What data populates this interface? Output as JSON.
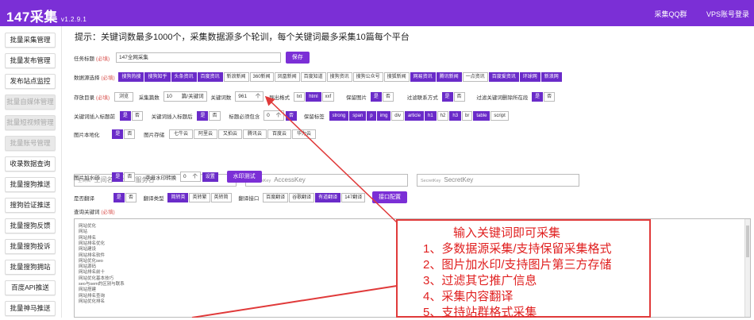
{
  "header": {
    "app_name": "147采集",
    "version": "v1.2.9.1",
    "links": [
      "采集QQ群",
      "VPS账号登录"
    ]
  },
  "sidebar": {
    "items": [
      {
        "label": "批量采集管理",
        "disabled": false
      },
      {
        "label": "批量发布管理",
        "disabled": false
      },
      {
        "label": "发布站点监控",
        "disabled": false
      },
      {
        "label": "批量自媒体管理",
        "disabled": true
      },
      {
        "label": "批量短视频管理",
        "disabled": true
      },
      {
        "label": "批量账号管理",
        "disabled": true
      },
      {
        "label": "收录数据查询",
        "disabled": false
      },
      {
        "label": "批量搜狗推送",
        "disabled": false
      },
      {
        "label": "搜狗验证推送",
        "disabled": false
      },
      {
        "label": "批量搜狗反馈",
        "disabled": false
      },
      {
        "label": "批量搜狗投诉",
        "disabled": false
      },
      {
        "label": "批量搜狗拥站",
        "disabled": false
      },
      {
        "label": "百度API推送",
        "disabled": false
      },
      {
        "label": "批量神马推送",
        "disabled": false
      }
    ]
  },
  "tip": "提示：关键词数最多1000个，采集数据源多个轮训，每个关键词最多采集10篇每个平台",
  "task": {
    "label": "任务标题",
    "required": "(必填)",
    "value": "147全网采集",
    "button": "保存"
  },
  "sources": {
    "label": "数据源选择",
    "required": "(必填)",
    "items": [
      {
        "t": "搜狗热搜",
        "on": true
      },
      {
        "t": "搜狗知乎",
        "on": true
      },
      {
        "t": "头条资讯",
        "on": true
      },
      {
        "t": "百度资讯",
        "on": true
      },
      {
        "t": "新浪新闻",
        "on": false
      },
      {
        "t": "360新闻",
        "on": false
      },
      {
        "t": "凤凰新闻",
        "on": false
      },
      {
        "t": "百度知道",
        "on": false
      },
      {
        "t": "搜狗资讯",
        "on": false
      },
      {
        "t": "搜狗公众号",
        "on": false
      },
      {
        "t": "搜狐新闻",
        "on": false
      },
      {
        "t": "网易资讯",
        "on": true
      },
      {
        "t": "腾讯新闻",
        "on": true
      },
      {
        "t": "一点资讯",
        "on": false
      },
      {
        "t": "百度爱资讯",
        "on": true
      },
      {
        "t": "环球网",
        "on": true
      },
      {
        "t": "新浪网",
        "on": true
      }
    ]
  },
  "storage": {
    "label": "存放目录",
    "required": "(必填)",
    "dir": "浏览",
    "collect_count_label": "采集篇数",
    "collect_count": "10",
    "collect_unit": "篇/关键词",
    "kw_count_label": "关键词数",
    "kw_count": "961",
    "kw_unit": "个",
    "export_label": "导出格式",
    "formats": [
      {
        "t": "txt",
        "on": false
      },
      {
        "t": "html",
        "on": true
      },
      {
        "t": "xxf",
        "on": false
      }
    ],
    "keep_img_label": "保留图片",
    "keep_img": [
      {
        "t": "是",
        "on": true
      },
      {
        "t": "否",
        "on": false
      }
    ],
    "filter_contact_label": "过滤联系方式",
    "filter_contact": [
      {
        "t": "是",
        "on": true
      },
      {
        "t": "否",
        "on": false
      }
    ],
    "filter_kw_label": "过滤关键词删除所在段",
    "filter_kw": [
      {
        "t": "是",
        "on": true
      },
      {
        "t": "否",
        "on": false
      }
    ]
  },
  "insert": {
    "kw_label": "关键词插入标题前",
    "kw": [
      {
        "t": "是",
        "on": true
      },
      {
        "t": "否",
        "on": false
      }
    ],
    "title_label": "关键词插入标题后",
    "title": [
      {
        "t": "是",
        "on": true
      },
      {
        "t": "否",
        "on": false
      }
    ],
    "must_label": "标题必须包含",
    "must_value": "0",
    "must_unit": "个",
    "must_btn": "否",
    "keep_tag_label": "保留标签",
    "tags": [
      {
        "t": "strong",
        "on": true
      },
      {
        "t": "span",
        "on": true
      },
      {
        "t": "p",
        "on": true
      },
      {
        "t": "img",
        "on": true
      },
      {
        "t": "div",
        "on": false
      },
      {
        "t": "article",
        "on": true
      },
      {
        "t": "h1",
        "on": true
      },
      {
        "t": "h2",
        "on": false
      },
      {
        "t": "h3",
        "on": true
      },
      {
        "t": "br",
        "on": false
      },
      {
        "t": "table",
        "on": true
      },
      {
        "t": "script",
        "on": false
      }
    ]
  },
  "imgloc": {
    "label": "图片本地化",
    "opts": [
      {
        "t": "是",
        "on": true
      },
      {
        "t": "否",
        "on": false
      }
    ],
    "store_label": "图片存储",
    "stores": [
      "七牛云",
      "阿里云",
      "又拍云",
      "腾讯云",
      "百度云",
      "华为云"
    ]
  },
  "cloud": {
    "space": {
      "prefix": "空间名",
      "placeholder": "空间名/bucket/服务名"
    },
    "access": {
      "prefix": "AccessKey",
      "placeholder": "AccessKey"
    },
    "secret": {
      "prefix": "SecretKey",
      "placeholder": "SecretKey"
    }
  },
  "watermark": {
    "label": "图片加水印",
    "opts": [
      {
        "t": "是",
        "on": true
      },
      {
        "t": "否",
        "on": false
      }
    ],
    "size_label": "字母水印转换",
    "size_value": "0",
    "size_unit": "个",
    "size_btn": "设置",
    "test_btn": "水印测试"
  },
  "translate": {
    "label": "是否翻译",
    "opts": [
      {
        "t": "是",
        "on": true
      },
      {
        "t": "否",
        "on": false
      }
    ],
    "type_label": "翻译类型",
    "types": [
      {
        "t": "简转英",
        "on": true
      },
      {
        "t": "英转繁",
        "on": false
      },
      {
        "t": "英转简",
        "on": false
      }
    ],
    "iface_label": "翻译接口",
    "ifaces": [
      {
        "t": "百度翻译",
        "on": false
      },
      {
        "t": "谷歌翻译",
        "on": false
      },
      {
        "t": "有道翻译",
        "on": true
      },
      {
        "t": "147翻译",
        "on": false
      }
    ],
    "config_btn": "接口配置"
  },
  "query": {
    "label": "查询关键词",
    "required": "(必填)",
    "keywords": [
      "网站优化",
      "网站",
      "网站排名",
      "网站排名优化",
      "网站建设",
      "网站排名软件",
      "网站优化seo",
      "网站源码",
      "网站排名前十",
      "网站优化基本技巧",
      "seo与sem的区别与联系",
      "网站搭建",
      "网站排名查询",
      "网站优化排名"
    ]
  },
  "annotation": {
    "lines": [
      "输入关键词即可采集",
      "1、多数据源采集/支持保留采集格式",
      "2、图片加水印/支持图片第三方存储",
      "3、过滤其它推广信息",
      "4、采集内容翻译",
      "5、支持站群格式采集"
    ],
    "color": "#e02020"
  }
}
